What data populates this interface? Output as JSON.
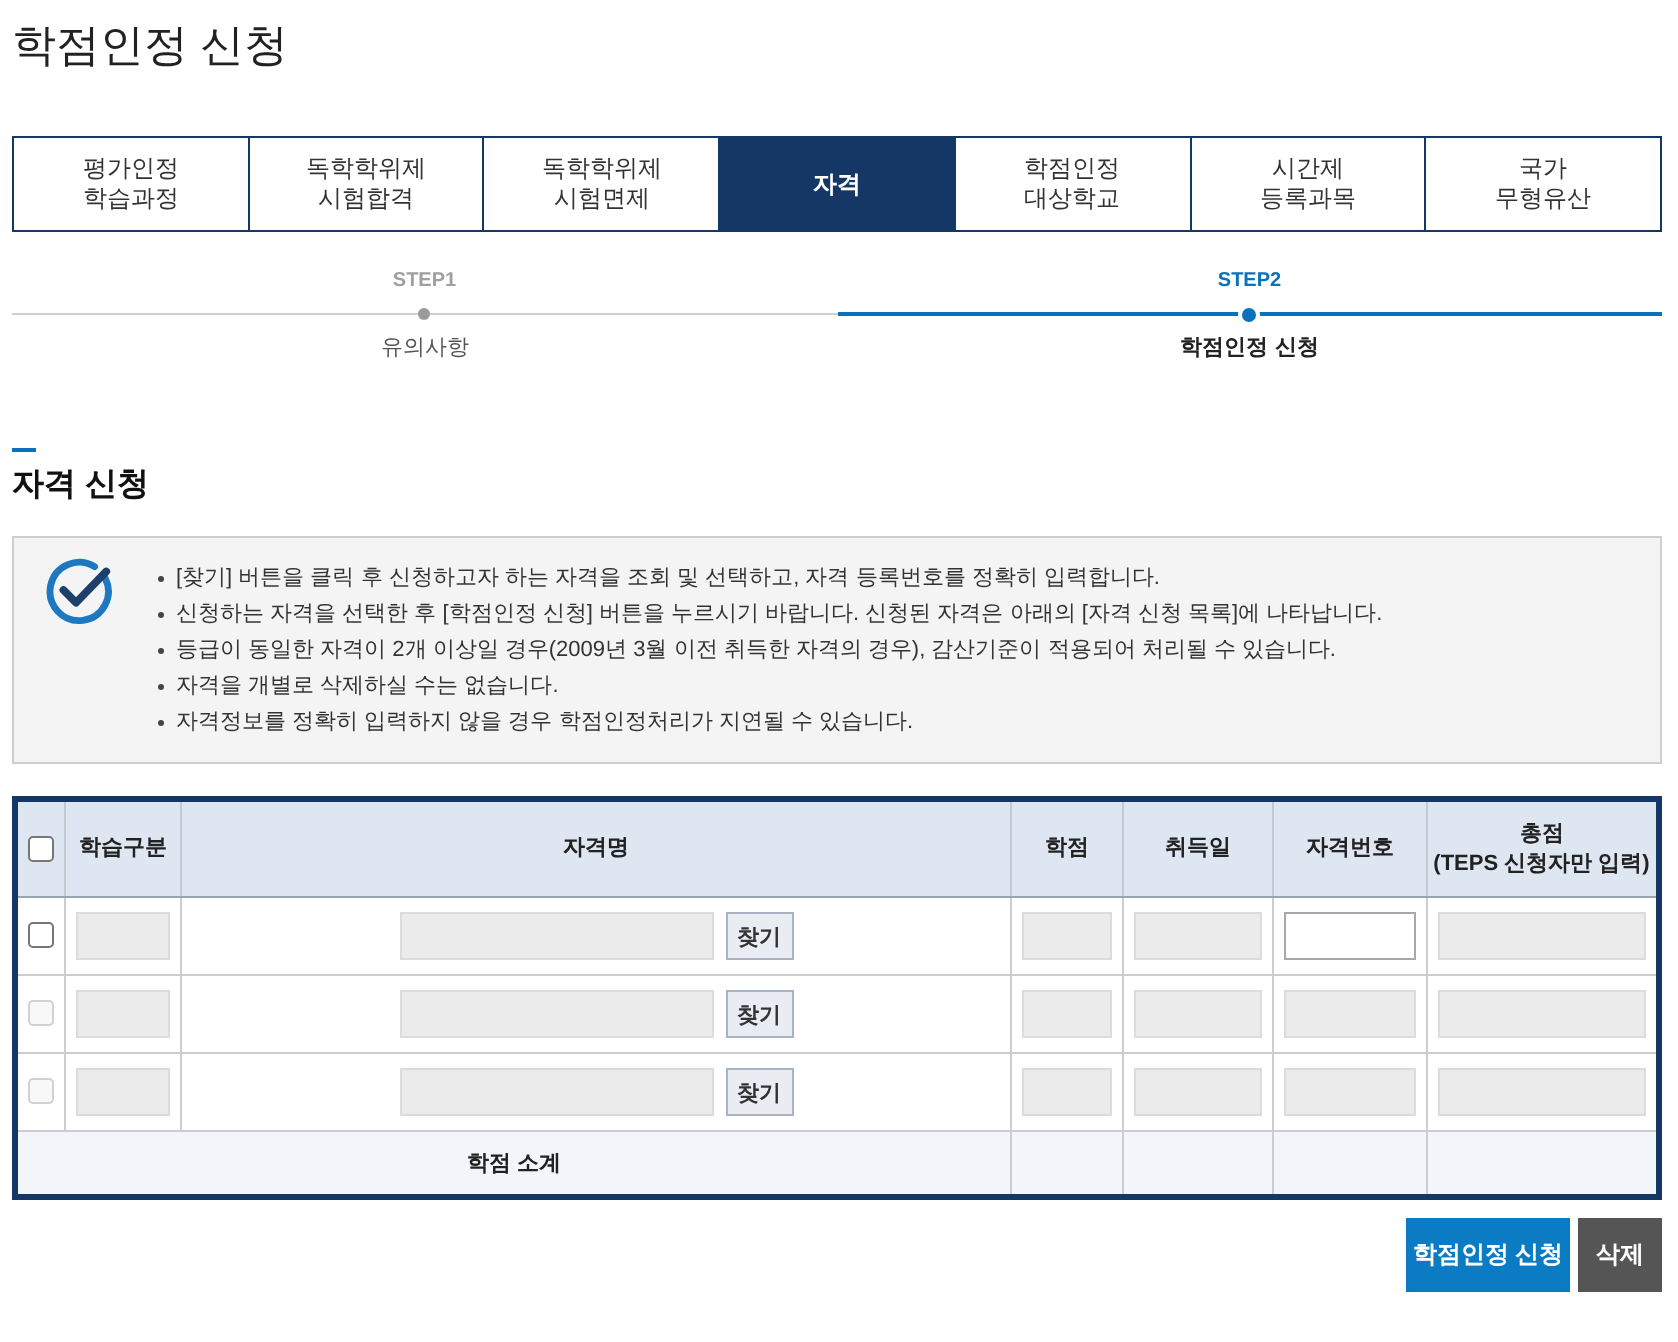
{
  "page": {
    "title": "학점인정 신청"
  },
  "tabs": [
    {
      "lines": [
        "평가인정",
        "학습과정"
      ],
      "selected": false
    },
    {
      "lines": [
        "독학학위제",
        "시험합격"
      ],
      "selected": false
    },
    {
      "lines": [
        "독학학위제",
        "시험면제"
      ],
      "selected": false
    },
    {
      "lines": [
        "자격"
      ],
      "selected": true
    },
    {
      "lines": [
        "학점인정",
        "대상학교"
      ],
      "selected": false
    },
    {
      "lines": [
        "시간제",
        "등록과목"
      ],
      "selected": false
    },
    {
      "lines": [
        "국가",
        "무형유산"
      ],
      "selected": false
    }
  ],
  "steps": [
    {
      "label": "STEP1",
      "title": "유의사항",
      "selected": false
    },
    {
      "label": "STEP2",
      "title": "학점인정 신청",
      "selected": true
    }
  ],
  "section": {
    "title": "자격 신청"
  },
  "notice": {
    "items": [
      "[찾기] 버튼을 클릭 후 신청하고자 하는 자격을 조회 및 선택하고, 자격 등록번호를 정확히 입력합니다.",
      "신청하는 자격을 선택한 후 [학점인정 신청] 버튼을 누르시기 바랍니다. 신청된 자격은 아래의 [자격 신청 목록]에 나타납니다.",
      "등급이 동일한 자격이 2개 이상일 경우(2009년 3월 이전 취득한 자격의 경우), 감산기준이 적용되어 처리될 수 있습니다.",
      "자격을 개별로 삭제하실 수는 없습니다.",
      "자격정보를 정확히 입력하지 않을 경우 학점인정처리가 지연될 수 있습니다."
    ]
  },
  "table": {
    "select_all": {
      "checked": false
    },
    "columns": [
      {
        "lines": [
          "학습구분"
        ]
      },
      {
        "lines": [
          "자격명"
        ]
      },
      {
        "lines": [
          "학점"
        ]
      },
      {
        "lines": [
          "취득일"
        ]
      },
      {
        "lines": [
          "자격번호"
        ]
      },
      {
        "lines": [
          "총점",
          "(TEPS 신청자만 입력)"
        ]
      }
    ],
    "rows": [
      {
        "checked": false,
        "disabled": false,
        "fields": [
          {
            "kind": "input",
            "disabled": true
          },
          {
            "kind": "search",
            "disabled": true,
            "button": "찾기"
          },
          {
            "kind": "input",
            "disabled": true
          },
          {
            "kind": "input",
            "disabled": true
          },
          {
            "kind": "input",
            "disabled": false
          },
          {
            "kind": "input",
            "disabled": true
          }
        ]
      },
      {
        "checked": false,
        "disabled": true,
        "fields": [
          {
            "kind": "input",
            "disabled": true
          },
          {
            "kind": "search",
            "disabled": true,
            "button": "찾기"
          },
          {
            "kind": "input",
            "disabled": true
          },
          {
            "kind": "input",
            "disabled": true
          },
          {
            "kind": "input",
            "disabled": true
          },
          {
            "kind": "input",
            "disabled": true
          }
        ]
      },
      {
        "checked": false,
        "disabled": true,
        "fields": [
          {
            "kind": "input",
            "disabled": true
          },
          {
            "kind": "search",
            "disabled": true,
            "button": "찾기"
          },
          {
            "kind": "input",
            "disabled": true
          },
          {
            "kind": "input",
            "disabled": true
          },
          {
            "kind": "input",
            "disabled": true
          },
          {
            "kind": "input",
            "disabled": true
          }
        ]
      }
    ],
    "subtotal": {
      "label": "학점 소계"
    }
  },
  "buttons": [
    {
      "label": "학점인정 신청",
      "kind": "primary"
    },
    {
      "label": "삭제",
      "kind": "secondary"
    }
  ]
}
